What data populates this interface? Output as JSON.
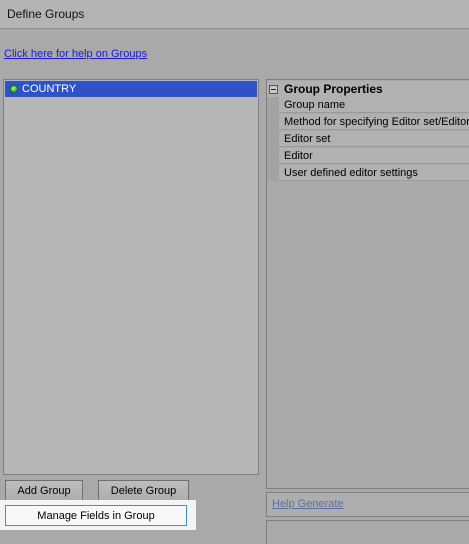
{
  "window": {
    "title": "Define Groups"
  },
  "help_link": {
    "text": "Click here for help on Groups"
  },
  "groups": {
    "items": [
      {
        "label": "COUNTRY",
        "selected": true
      }
    ]
  },
  "properties": {
    "header": "Group Properties",
    "rows": [
      "Group name",
      "Method for specifying Editor set/Editor",
      "Editor set",
      "Editor",
      "User defined editor settings"
    ]
  },
  "help_generate": {
    "text": "Help Generate"
  },
  "buttons": {
    "add": "Add Group",
    "delete": "Delete Group",
    "manage": "Manage Fields in Group"
  },
  "colors": {
    "selection": "#2f52c9",
    "link": "#1a1ae0",
    "focus_border": "#3d8ee0"
  }
}
